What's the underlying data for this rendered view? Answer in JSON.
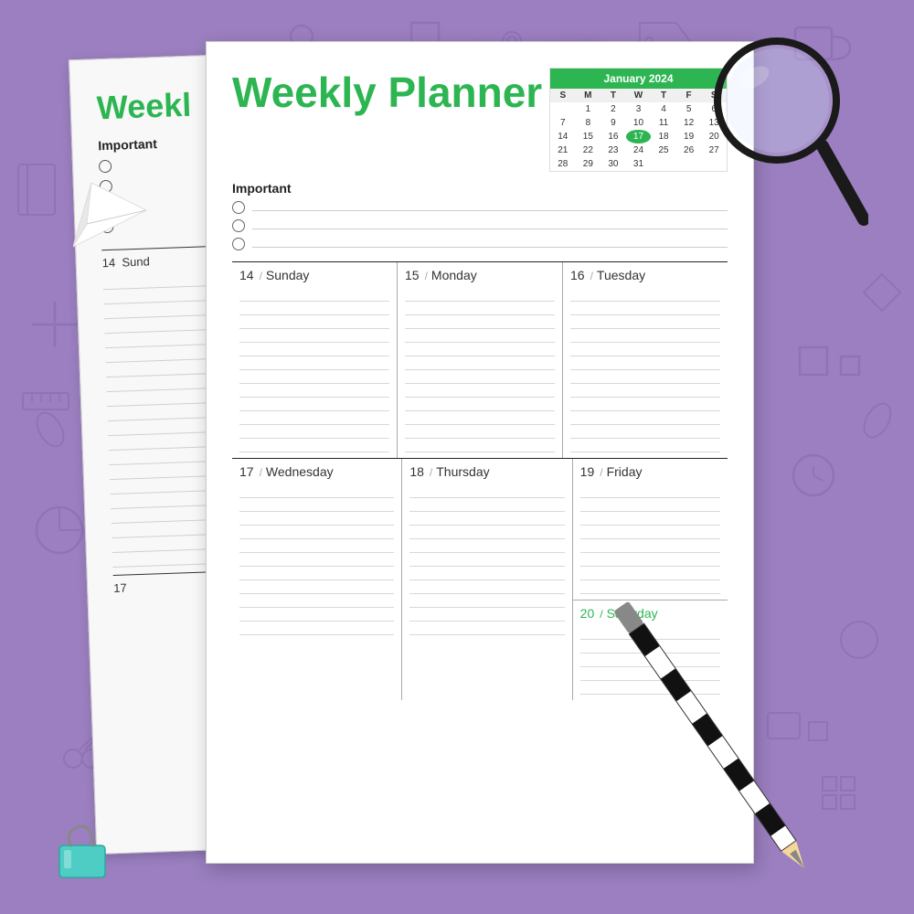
{
  "page": {
    "title": "Weekly Planner",
    "background_color": "#9b7fc0"
  },
  "back_page": {
    "title": "Weekl",
    "important_label": "Important"
  },
  "main_page": {
    "title": "Weekly Planner",
    "important_label": "Important",
    "checkboxes": [
      "",
      "",
      ""
    ],
    "calendar": {
      "month_year": "January 2024",
      "headers": [
        "S",
        "M",
        "T",
        "W",
        "T",
        "F",
        "S"
      ],
      "weeks": [
        [
          "",
          "",
          "1",
          "2",
          "3",
          "4",
          "5",
          "6"
        ],
        [
          "7",
          "8",
          "9",
          "10",
          "11",
          "12",
          "13"
        ],
        [
          "14",
          "15",
          "16",
          "17",
          "18",
          "19",
          "20"
        ],
        [
          "21",
          "22",
          "23",
          "24",
          "25",
          "26",
          "27"
        ],
        [
          "28",
          "29",
          "30",
          "31",
          "",
          "",
          ""
        ]
      ],
      "today_date": "17"
    },
    "days_row1": [
      {
        "num": "14",
        "name": "Sunday"
      },
      {
        "num": "15",
        "name": "Monday"
      },
      {
        "num": "16",
        "name": "Tuesday"
      }
    ],
    "days_row2": [
      {
        "num": "17",
        "name": "Wednesday"
      },
      {
        "num": "18",
        "name": "Thursday"
      },
      {
        "num": "19",
        "name": "Friday"
      }
    ],
    "saturday": {
      "num": "20",
      "name": "Saturday"
    }
  }
}
